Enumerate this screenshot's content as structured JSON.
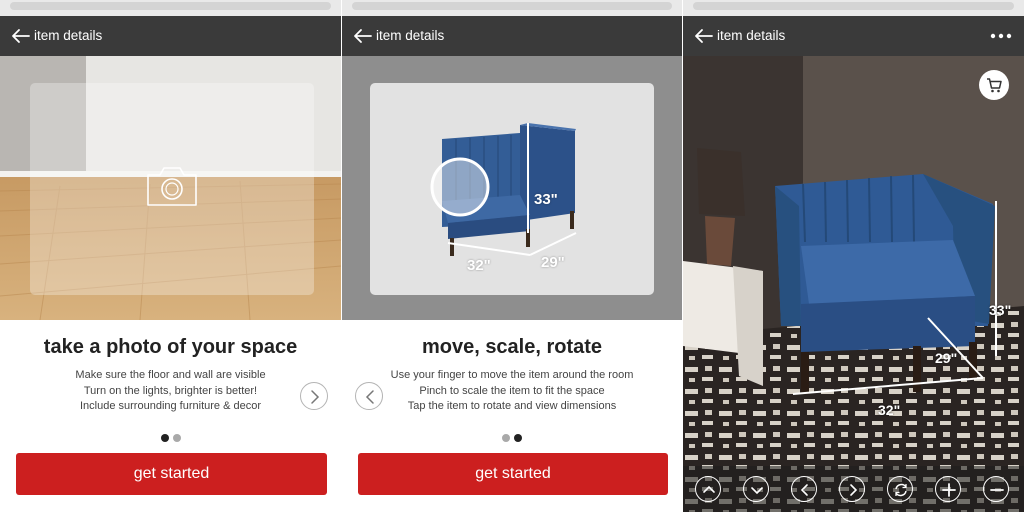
{
  "panels": [
    {
      "header_title": "item details",
      "heading": "take a photo of your space",
      "description": [
        "Make sure the floor and wall are visible",
        "Turn on the lights, brighter is better!",
        "Include surrounding furniture & decor"
      ],
      "cta_label": "get started",
      "page_indicator": {
        "active": 1,
        "total": 2
      }
    },
    {
      "header_title": "item details",
      "heading": "move, scale, rotate",
      "description": [
        "Use your finger to move the item around the room",
        "Pinch to scale the item to fit the space",
        "Tap the item to rotate and view dimensions"
      ],
      "dimensions": {
        "height": "33\"",
        "width": "32\"",
        "depth": "29\""
      },
      "cta_label": "get started",
      "page_indicator": {
        "active": 2,
        "total": 2
      }
    },
    {
      "header_title": "item details",
      "dimensions": {
        "height": "33\"",
        "width": "32\"",
        "depth": "29\""
      },
      "toolbar_icons": [
        "chevron-up-icon",
        "chevron-down-icon",
        "chevron-left-icon",
        "chevron-right-icon",
        "rotate-icon",
        "plus-icon",
        "minus-icon"
      ]
    }
  ],
  "colors": {
    "header_bg": "#3a3a3a",
    "cta_red": "#cc1f1f",
    "chair_blue": "#2f5a95",
    "dot_active": "#222222",
    "dot_inactive": "#a9a9a9"
  }
}
